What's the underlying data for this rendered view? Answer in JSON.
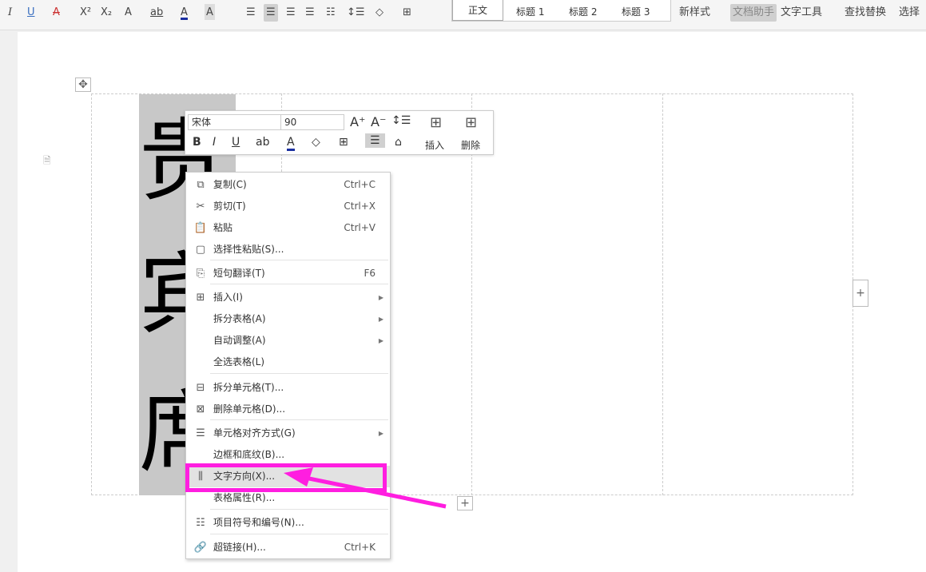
{
  "ribbon": {
    "italic": "I",
    "underline": "U",
    "strike": "A",
    "superscript": "X²",
    "subscript": "X₂",
    "effect": "A",
    "highlight": "ab",
    "font_color": "A",
    "char_shade": "A",
    "styles": [
      "正文",
      "标题 1",
      "标题 2",
      "标题 3"
    ],
    "new_style": "新样式",
    "doc_assistant": "文档助手",
    "text_tools": "文字工具",
    "find_replace": "查找替换",
    "select": "选择"
  },
  "mini_toolbar": {
    "font": "宋体",
    "size": "90",
    "insert": "插入",
    "delete": "删除",
    "bold": "B",
    "italic": "I",
    "underline": "U",
    "font_color": "A"
  },
  "cell_text": [
    "贵",
    "宾",
    "席"
  ],
  "context_menu": [
    {
      "label": "复制(C)",
      "shortcut": "Ctrl+C",
      "icon": "copy-icon"
    },
    {
      "label": "剪切(T)",
      "shortcut": "Ctrl+X",
      "icon": "cut-icon"
    },
    {
      "label": "粘贴",
      "shortcut": "Ctrl+V",
      "icon": "paste-icon"
    },
    {
      "label": "选择性粘贴(S)...",
      "shortcut": "",
      "icon": "paste-special-icon"
    },
    {
      "label": "短句翻译(T)",
      "shortcut": "F6",
      "icon": "translate-icon"
    },
    {
      "label": "插入(I)",
      "shortcut": "",
      "icon": "table-insert-icon",
      "submenu": true
    },
    {
      "label": "拆分表格(A)",
      "shortcut": "",
      "submenu": true
    },
    {
      "label": "自动调整(A)",
      "shortcut": "",
      "submenu": true
    },
    {
      "label": "全选表格(L)",
      "shortcut": ""
    },
    {
      "label": "拆分单元格(T)...",
      "shortcut": "",
      "icon": "split-cell-icon"
    },
    {
      "label": "删除单元格(D)...",
      "shortcut": "",
      "icon": "delete-cell-icon"
    },
    {
      "label": "单元格对齐方式(G)",
      "shortcut": "",
      "icon": "align-icon",
      "submenu": true
    },
    {
      "label": "边框和底纹(B)...",
      "shortcut": ""
    },
    {
      "label": "文字方向(X)...",
      "shortcut": "",
      "icon": "text-direction-icon",
      "highlighted": true
    },
    {
      "label": "表格属性(R)...",
      "shortcut": ""
    },
    {
      "label": "项目符号和编号(N)...",
      "shortcut": "",
      "icon": "list-icon"
    },
    {
      "label": "超链接(H)...",
      "shortcut": "Ctrl+K",
      "icon": "link-icon"
    }
  ],
  "colors": {
    "highlight": "#ff1ee0"
  }
}
